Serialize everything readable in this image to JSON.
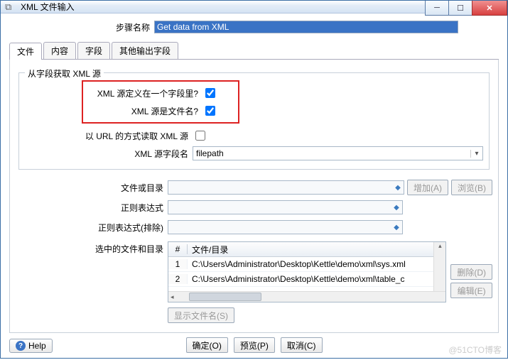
{
  "window": {
    "title": "XML 文件输入"
  },
  "step": {
    "label": "步骤名称",
    "value": "Get data from XML"
  },
  "tabs": {
    "file": "文件",
    "content": "内容",
    "fields": "字段",
    "extra": "其他输出字段"
  },
  "fieldset": {
    "legend": "从字段获取 XML 源",
    "defined_in_field": "XML 源定义在一个字段里?",
    "is_filename": "XML 源是文件名?",
    "read_url": "以 URL 的方式读取 XML 源",
    "field_name_label": "XML 源字段名",
    "field_name_value": "filepath"
  },
  "rows": {
    "file_or_dir": "文件或目录",
    "regex": "正则表达式",
    "regex_exclude": "正则表达式(排除)",
    "selected": "选中的文件和目录"
  },
  "buttons": {
    "add": "增加(A)",
    "browse": "浏览(B)",
    "delete": "删除(D)",
    "edit": "编辑(E)",
    "show_filenames": "显示文件名(S)",
    "ok": "确定(O)",
    "preview": "预览(P)",
    "cancel": "取消(C)",
    "help": "Help"
  },
  "table": {
    "hash": "#",
    "header": "文件/目录",
    "rows": [
      {
        "n": "1",
        "path": "C:\\Users\\Administrator\\Desktop\\Kettle\\demo\\xml\\sys.xml"
      },
      {
        "n": "2",
        "path": "C:\\Users\\Administrator\\Desktop\\Kettle\\demo\\xml\\table_c"
      }
    ]
  },
  "watermark": "@51CTO博客"
}
